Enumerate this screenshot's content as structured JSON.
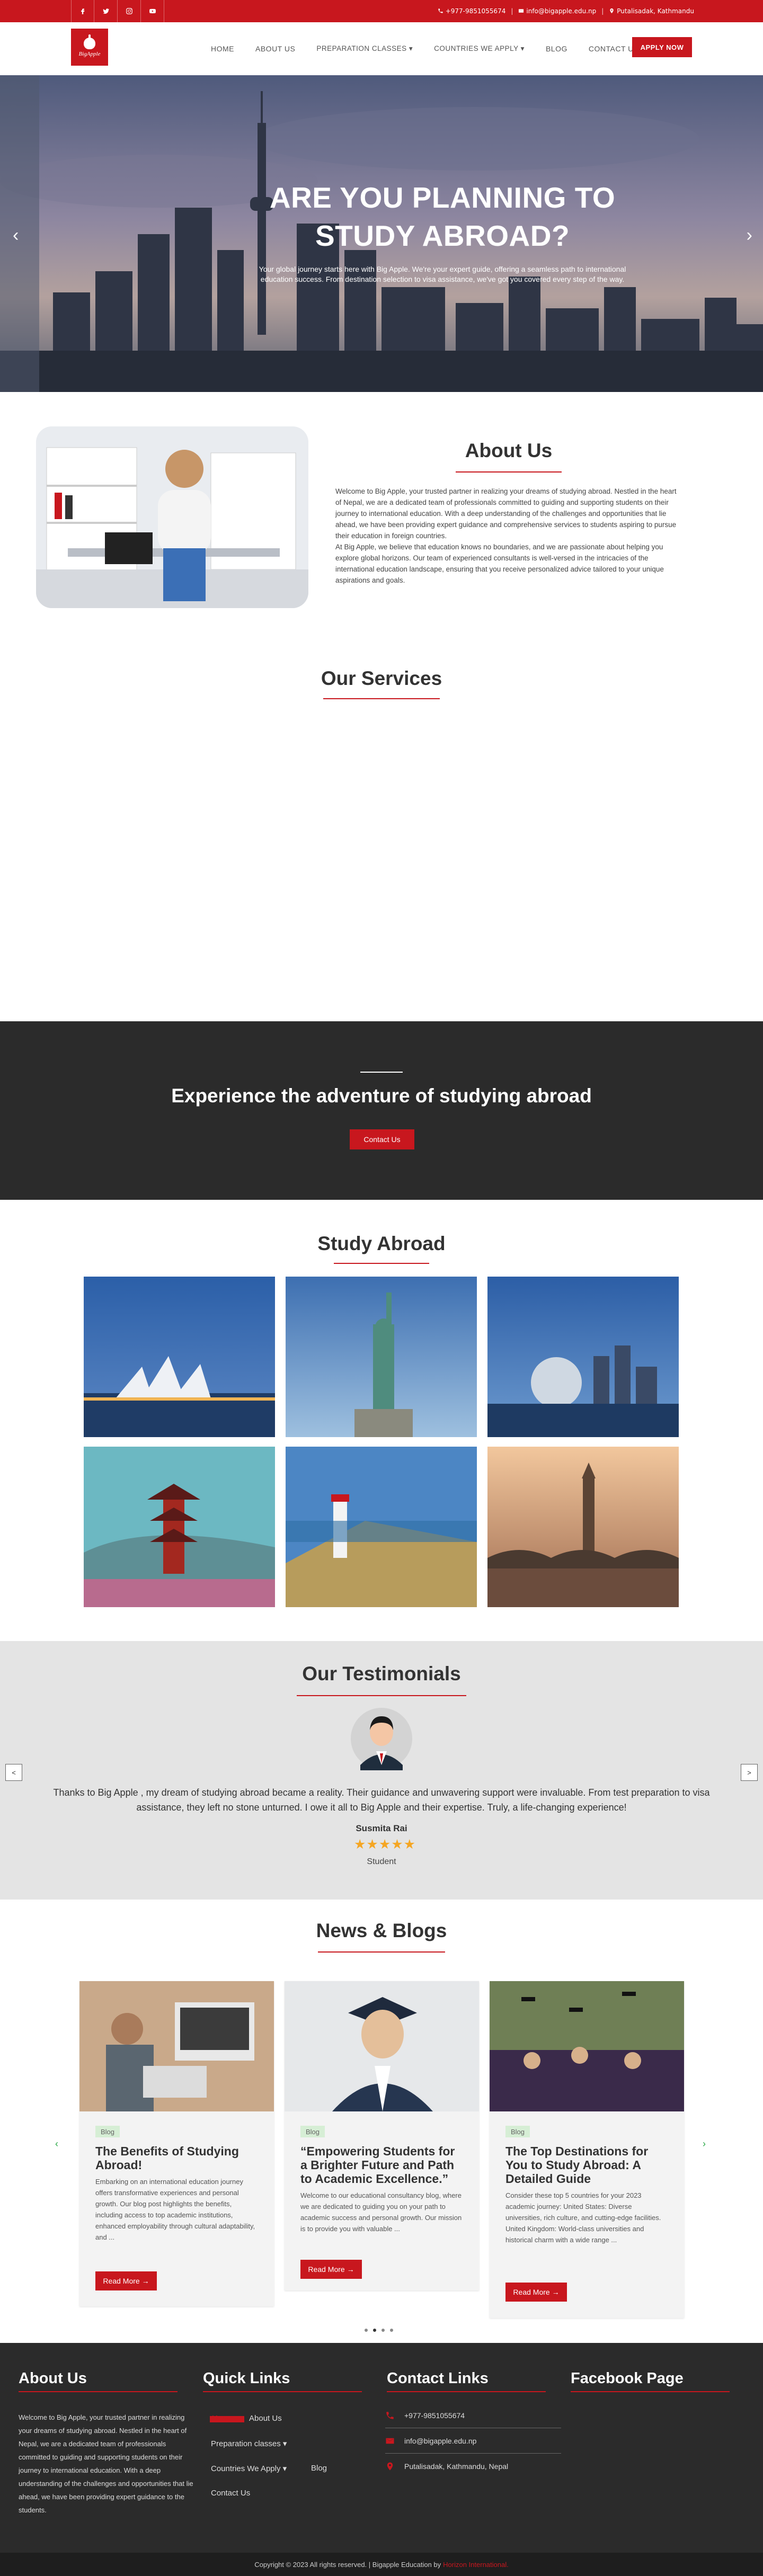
{
  "topbar": {
    "phone": "+977-9851055674",
    "email": "info@bigapple.edu.np",
    "location": "Putalisadak, Kathmandu"
  },
  "nav": {
    "logo_text": "BigApple",
    "items": [
      "HOME",
      "ABOUT US",
      "PREPARATION CLASSES ▾",
      "COUNTRIES WE APPLY ▾",
      "BLOG",
      "CONTACT US"
    ],
    "apply_label": "APPLY NOW"
  },
  "hero": {
    "title_line1": "ARE YOU PLANNING TO",
    "title_line2": "STUDY ABROAD?",
    "subtitle": "Your global journey starts here with Big Apple. We're your expert guide, offering a seamless path to international education success. From destination selection to visa assistance, we've got you covered every step of the way."
  },
  "about": {
    "title": "About Us",
    "para1": "Welcome to Big Apple, your trusted partner in realizing your dreams of studying abroad. Nestled in the heart of Nepal, we are a dedicated team of professionals committed to guiding and supporting students on their journey to international education. With a deep understanding of the challenges and opportunities that lie ahead, we have been providing expert guidance and comprehensive services to students aspiring to pursue their education in foreign countries.",
    "para2": "At Big Apple, we believe that education knows no boundaries, and we are passionate about helping you explore global horizons. Our team of experienced consultants is well-versed in the intricacies of the international education landscape, ensuring that you receive personalized advice tailored to your unique aspirations and goals."
  },
  "services": {
    "title": "Our Services"
  },
  "cta": {
    "title": "Experience the adventure of studying abroad",
    "button": "Contact Us"
  },
  "study_abroad": {
    "title": "Study Abroad"
  },
  "testimonials": {
    "title": "Our Testimonials",
    "quote": "Thanks to Big Apple , my dream of studying abroad became a reality. Their guidance and unwavering support were invaluable. From test preparation to visa assistance, they left no stone unturned. I owe it all to Big Apple and their expertise. Truly, a life-changing experience!",
    "name": "Susmita Rai",
    "stars": "★★★★★",
    "role": "Student"
  },
  "news": {
    "title": "News & Blogs",
    "cards": [
      {
        "badge": "Blog",
        "title": "The Benefits of Studying Abroad!",
        "excerpt": "Embarking on an international education journey offers transformative experiences and personal growth. Our blog post highlights the benefits, including access to top academic institutions, enhanced employability through cultural adaptability, and ...",
        "button": "Read More →"
      },
      {
        "badge": "Blog",
        "title": "“Empowering Students for a Brighter Future and Path to Academic Excellence.”",
        "excerpt": "Welcome to our educational consultancy blog, where we are dedicated to guiding you on your path to academic success and personal growth. Our mission is to provide you with valuable ...",
        "button": "Read More →"
      },
      {
        "badge": "Blog",
        "title": "The Top Destinations for You to Study Abroad: A Detailed Guide",
        "excerpt": "Consider these top 5 countries for your 2023 academic journey: United States: Diverse universities, rich culture, and cutting-edge facilities. United Kingdom: World-class universities and historical charm with a wide range ...",
        "button": "Read More →"
      }
    ]
  },
  "footer": {
    "about_title": "About Us",
    "about_text": "Welcome to Big Apple, your trusted partner in realizing your dreams of studying abroad. Nestled in the heart of Nepal, we are a dedicated team of professionals committed to guiding and supporting students on their journey to international education. With a deep understanding of the challenges and opportunities that lie ahead, we have been providing expert guidance to the students.",
    "quick_title": "Quick Links",
    "quick_links": [
      "Home",
      "About Us",
      "Preparation classes ▾",
      "Countries We Apply ▾",
      "Blog",
      "Contact Us"
    ],
    "contact_title": "Contact Links",
    "phone": "+977-9851055674",
    "email": "info@bigapple.edu.np",
    "address": "Putalisadak, Kathmandu, Nepal",
    "facebook_title": "Facebook Page",
    "copyright": "Copyright © 2023 All rights reserved. | Bigapple Education by",
    "credit": "Horizon International."
  },
  "colors": {
    "accent": "#c8171e",
    "dark": "#2b2b2b"
  }
}
